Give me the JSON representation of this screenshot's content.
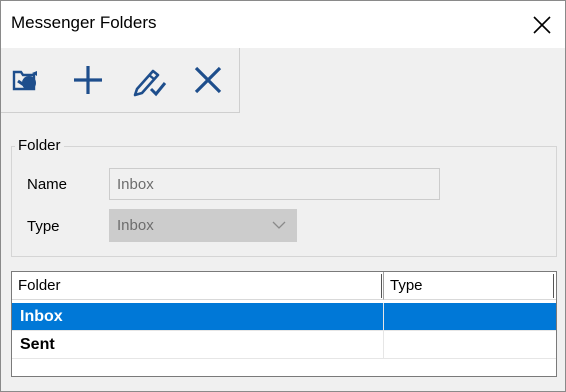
{
  "window": {
    "title": "Messenger Folders"
  },
  "toolbar": {
    "buttons": [
      {
        "name": "folder-sync",
        "icon": "folder-sync-icon"
      },
      {
        "name": "add",
        "icon": "plus-icon"
      },
      {
        "name": "edit",
        "icon": "pencil-check-icon"
      },
      {
        "name": "delete",
        "icon": "x-icon"
      }
    ]
  },
  "folder_group": {
    "legend": "Folder",
    "name_label": "Name",
    "name_value": "Inbox",
    "type_label": "Type",
    "type_value": "Inbox"
  },
  "grid": {
    "columns": [
      "Folder",
      "Type"
    ],
    "rows": [
      {
        "folder": "Inbox",
        "type": "",
        "selected": true
      },
      {
        "folder": "Sent",
        "type": "",
        "selected": false
      }
    ]
  },
  "colors": {
    "selection": "#0078d7",
    "accent": "#1e4e8c"
  }
}
